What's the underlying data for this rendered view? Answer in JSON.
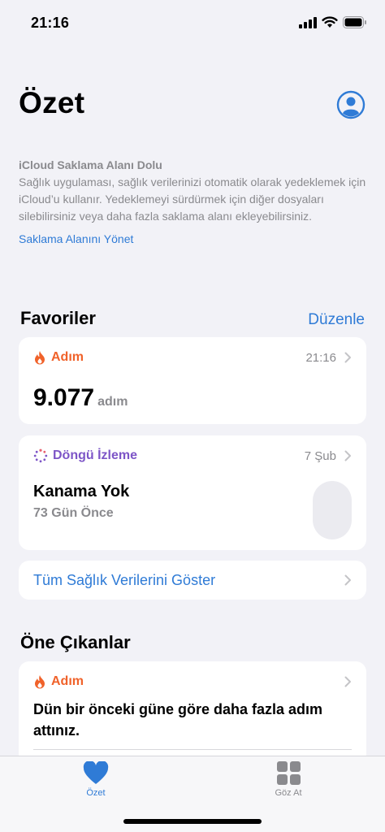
{
  "status": {
    "time": "21:16"
  },
  "header": {
    "title": "Özet"
  },
  "notice": {
    "title": "iCloud Saklama Alanı Dolu",
    "body": "Sağlık uygulaması, sağlık verilerinizi otomatik olarak yedeklemek için iCloud’u kullanır. Yedeklemeyi sürdürmek için diğer dosyaları silebilirsiniz veya daha fazla saklama alanı ekleyebilirsiniz.",
    "link": "Saklama Alanını Yönet"
  },
  "favorites": {
    "title": "Favoriler",
    "edit_label": "Düzenle",
    "steps": {
      "label": "Adım",
      "time": "21:16",
      "value": "9.077",
      "unit": "adım"
    },
    "cycle": {
      "label": "Döngü İzleme",
      "date": "7 Şub",
      "title": "Kanama Yok",
      "subtitle": "73 Gün Önce"
    },
    "show_all": "Tüm Sağlık Verilerini Göster"
  },
  "highlights": {
    "title": "Öne Çıkanlar",
    "card": {
      "label": "Adım",
      "text": "Dün bir önceki güne göre daha fazla adım attınız."
    }
  },
  "tabbar": {
    "items": [
      {
        "label": "Özet",
        "icon": "heart-icon",
        "active": true
      },
      {
        "label": "Göz At",
        "icon": "grid-icon",
        "active": false
      }
    ]
  },
  "colors": {
    "accent": "#2f7bd6",
    "activity": "#f0622a",
    "cycle": "#7d55c7",
    "background": "#f2f2f7"
  }
}
